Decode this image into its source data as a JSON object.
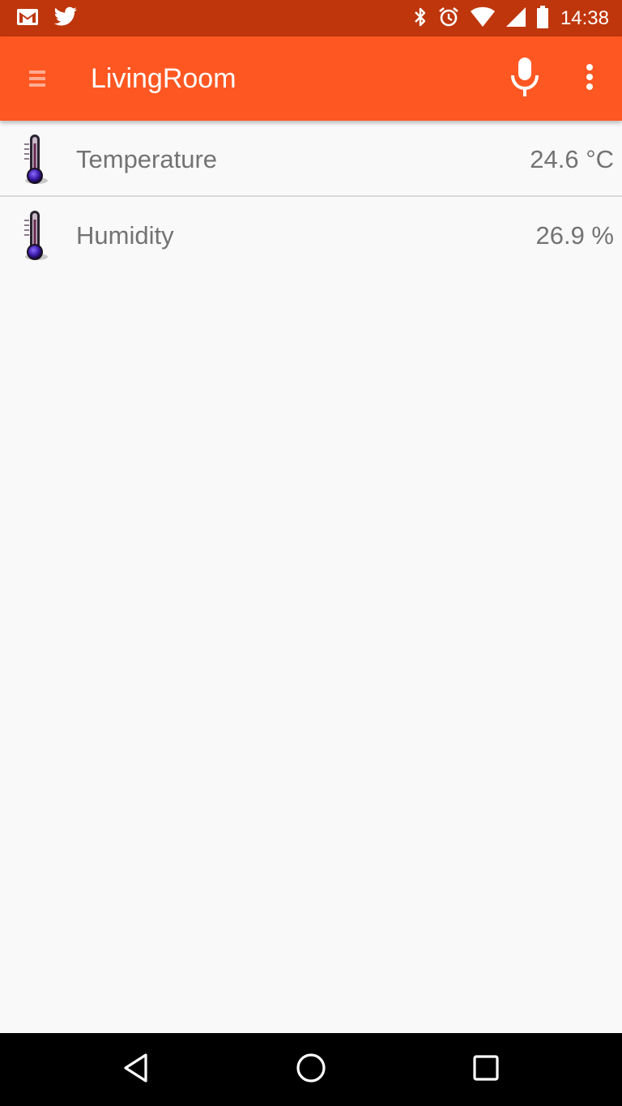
{
  "status_bar": {
    "time": "14:38",
    "background": "#bf360c",
    "left_icons": [
      "gmail-icon",
      "twitter-icon"
    ],
    "right_icons": [
      "bluetooth-icon",
      "alarm-icon",
      "wifi-icon",
      "cell-signal-icon",
      "battery-icon"
    ]
  },
  "app_bar": {
    "title": "LivingRoom",
    "background": "#ff5722",
    "icons": [
      "menu-icon",
      "microphone-icon",
      "overflow-menu-icon"
    ]
  },
  "sensors": [
    {
      "label": "Temperature",
      "value": "24.6 °C",
      "icon": "thermometer-icon"
    },
    {
      "label": "Humidity",
      "value": "26.9 %",
      "icon": "thermometer-icon"
    }
  ],
  "nav_bar": {
    "buttons": [
      "back-icon",
      "home-icon",
      "recents-icon"
    ]
  }
}
